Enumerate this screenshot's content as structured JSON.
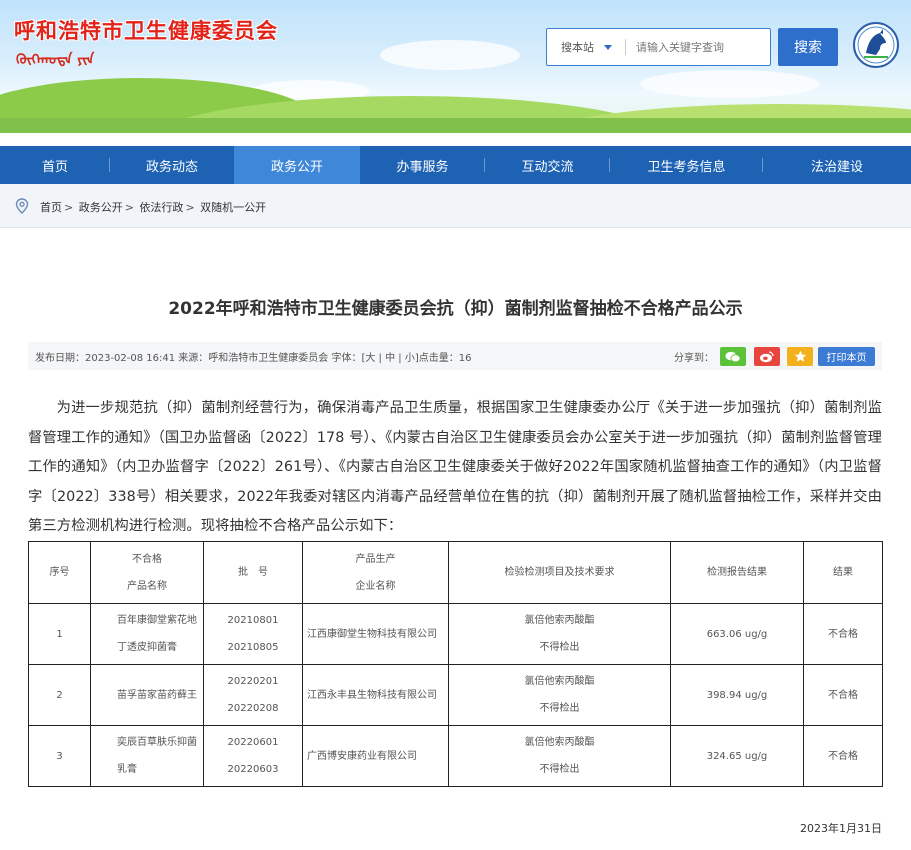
{
  "header": {
    "site_title": "呼和浩特市卫生健康委员会",
    "site_title_mongolian": "ᠬᠥᠬᠡᠬᠣᠲᠠ ᠶᠢᠨ",
    "search": {
      "scope_label": "搜本站",
      "placeholder": "请输入关键字查询",
      "button_label": "搜索"
    }
  },
  "nav": {
    "items": [
      {
        "label": "首页"
      },
      {
        "label": "政务动态"
      },
      {
        "label": "政务公开"
      },
      {
        "label": "办事服务"
      },
      {
        "label": "互动交流"
      },
      {
        "label": "卫生考务信息"
      },
      {
        "label": "法治建设"
      }
    ]
  },
  "breadcrumb": {
    "items": [
      "首页",
      "政务公开",
      "依法行政",
      "双随机一公开"
    ]
  },
  "article": {
    "title": "2022年呼和浩特市卫生健康委员会抗（抑）菌制剂监督抽检不合格产品公示",
    "meta": "发布日期：2023-02-08 16:41   来源：呼和浩特市卫生健康委员会   字体：[大 | 中 | 小]点击量：16",
    "share_label": "分享到：",
    "print_label": "打印本页",
    "body": "为进一步规范抗（抑）菌制剂经营行为，确保消毒产品卫生质量，根据国家卫生健康委办公厅《关于进一步加强抗（抑）菌制剂监督管理工作的通知》（国卫办监督函〔2022〕178 号）、《内蒙古自治区卫生健康委员会办公室关于进一步加强抗（抑）菌制剂监督管理工作的通知》（内卫办监督字〔2022〕261号）、《内蒙古自治区卫生健康委关于做好2022年国家随机监督抽查工作的通知》（内卫监督字〔2022〕338号）相关要求，2022年我委对辖区内消毒产品经营单位在售的抗（抑）菌制剂开展了随机监督抽检工作，采样并交由第三方检测机构进行检测。现将抽检不合格产品公示如下：",
    "date": "2023年1月31日"
  },
  "table": {
    "headers": {
      "seq": "序号",
      "name_line1": "不合格",
      "name_line2": "产品名称",
      "batch": "批　号",
      "maker_line1": "产品生产",
      "maker_line2": "企业名称",
      "test_item": "检验检测项目及技术要求",
      "report": "检测报告结果",
      "result": "结果"
    },
    "rows": [
      {
        "seq": "1",
        "name": "百年康御堂紫花地丁透皮抑菌膏",
        "batch1": "20210801",
        "batch2": "20210805",
        "maker": "江西康御堂生物科技有限公司",
        "test1": "氯倍他索丙酸酯",
        "test2": "不得检出",
        "report": "663.06 ug/g",
        "result": "不合格"
      },
      {
        "seq": "2",
        "name": "苗孚苗家苗药藓王",
        "batch1": "20220201",
        "batch2": "20220208",
        "maker": "江西永丰县生物科技有限公司",
        "test1": "氯倍他索丙酸酯",
        "test2": "不得检出",
        "report": "398.94 ug/g",
        "result": "不合格"
      },
      {
        "seq": "3",
        "name": "奕辰百草肤乐抑菌乳膏",
        "batch1": "20220601",
        "batch2": "20220603",
        "maker": "广西博安康药业有限公司",
        "test1": "氯倍他索丙酸酯",
        "test2": "不得检出",
        "report": "324.65 ug/g",
        "result": "不合格"
      }
    ]
  },
  "colors": {
    "nav_bg": "#1e62b4",
    "nav_active": "#3f87d9",
    "title_red": "#e2231a",
    "button_blue": "#2f6fcc"
  }
}
